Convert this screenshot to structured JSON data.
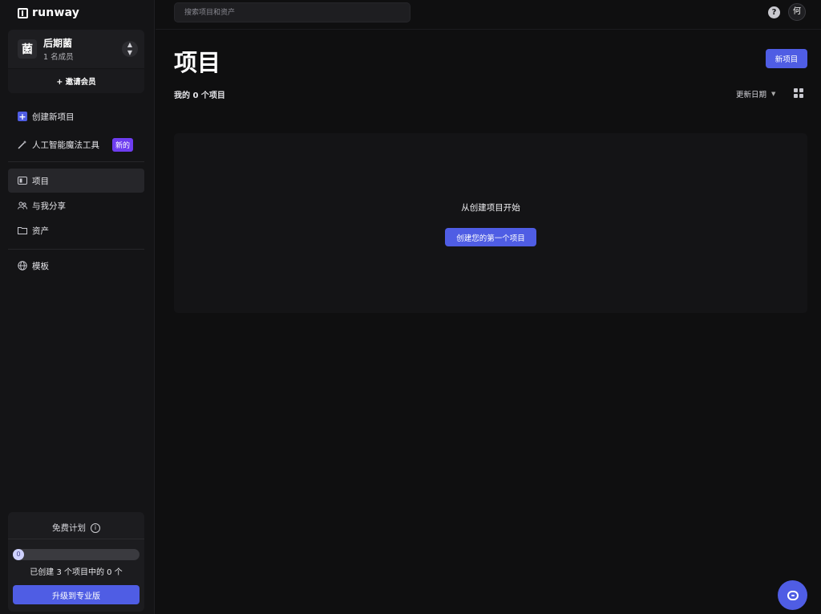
{
  "app": {
    "logo_text": "runway"
  },
  "team": {
    "avatar": "菌",
    "name": "后期菌",
    "members": "1 名成员",
    "invite_label": "+ 邀请会员"
  },
  "sidebar": {
    "actions": [
      {
        "label": "创建新项目",
        "icon": "plus-square-icon"
      },
      {
        "label": "人工智能魔法工具",
        "icon": "magic-wand-icon",
        "badge": "新的"
      }
    ],
    "nav": [
      {
        "label": "项目",
        "icon": "projects-icon",
        "active": true
      },
      {
        "label": "与我分享",
        "icon": "shared-icon"
      },
      {
        "label": "资产",
        "icon": "folder-icon"
      }
    ],
    "extra": [
      {
        "label": "模板",
        "icon": "globe-icon"
      }
    ]
  },
  "plan": {
    "title": "免费计划",
    "progress_value": "0",
    "progress_fraction": 0,
    "count_text": "已创建 3 个项目中的 0 个",
    "upgrade_label": "升级到专业版"
  },
  "topbar": {
    "search_placeholder": "搜索项目和资产",
    "help_icon": "?",
    "user_avatar": "何"
  },
  "main": {
    "title": "项目",
    "new_project_label": "新项目",
    "project_count": "我的 0 个项目",
    "sort_label": "更新日期",
    "empty_title": "从创建项目开始",
    "first_project_label": "创建您的第一个项目"
  },
  "colors": {
    "accent": "#4f5de4",
    "badge": "#6e3df0",
    "background": "#0f0f10"
  }
}
